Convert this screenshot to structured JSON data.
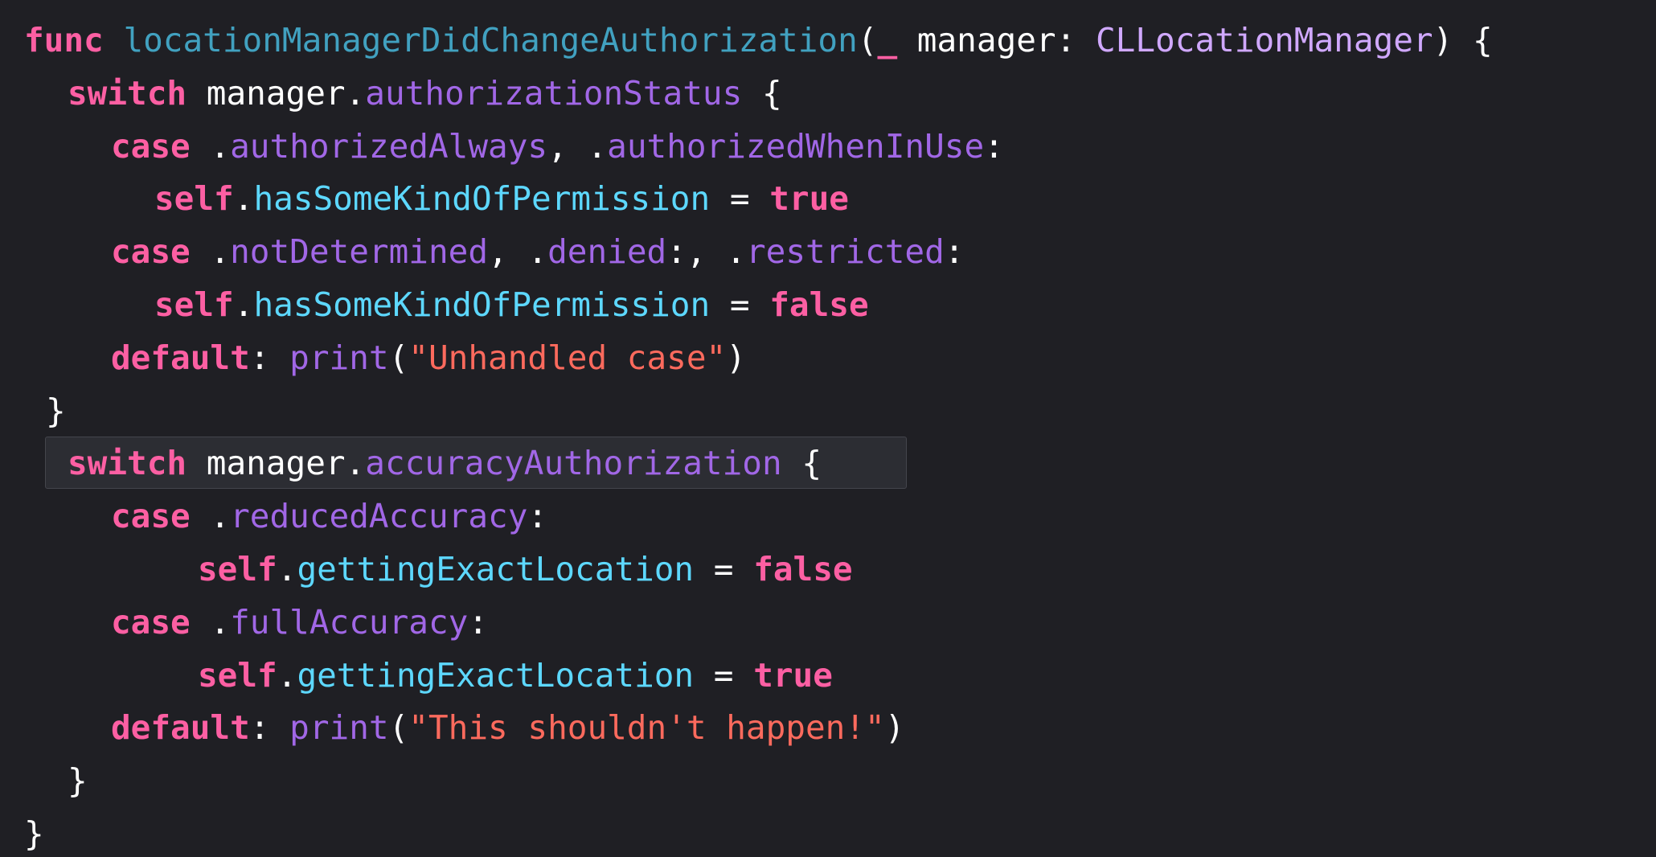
{
  "colors": {
    "background": "#1f1f24",
    "keyword": "#fc5fa3",
    "function_name": "#41a1c0",
    "type": "#d0a8ff",
    "property": "#a167e6",
    "plain": "#ffffff",
    "string": "#fc6a5d",
    "instance_property": "#5dd8ff",
    "highlight": "#2c2d33"
  },
  "code": {
    "lines": [
      {
        "indent": 0,
        "highlighted": false,
        "tokens": [
          {
            "text": "func",
            "kind": "keyword"
          },
          {
            "text": " ",
            "kind": "plain"
          },
          {
            "text": "locationManagerDidChangeAuthorization",
            "kind": "function_name"
          },
          {
            "text": "(",
            "kind": "plain"
          },
          {
            "text": "_",
            "kind": "keyword"
          },
          {
            "text": " manager: ",
            "kind": "plain"
          },
          {
            "text": "CLLocationManager",
            "kind": "type"
          },
          {
            "text": ") {",
            "kind": "plain"
          }
        ]
      },
      {
        "indent": 1,
        "highlighted": false,
        "tokens": [
          {
            "text": "switch",
            "kind": "keyword"
          },
          {
            "text": " manager.",
            "kind": "plain"
          },
          {
            "text": "authorizationStatus",
            "kind": "property"
          },
          {
            "text": " {",
            "kind": "plain"
          }
        ]
      },
      {
        "indent": 2,
        "highlighted": false,
        "tokens": [
          {
            "text": "case",
            "kind": "keyword"
          },
          {
            "text": " .",
            "kind": "plain"
          },
          {
            "text": "authorizedAlways",
            "kind": "property"
          },
          {
            "text": ", .",
            "kind": "plain"
          },
          {
            "text": "authorizedWhenInUse",
            "kind": "property"
          },
          {
            "text": ":",
            "kind": "plain"
          }
        ]
      },
      {
        "indent": 3,
        "highlighted": false,
        "tokens": [
          {
            "text": "self",
            "kind": "keyword"
          },
          {
            "text": ".",
            "kind": "plain"
          },
          {
            "text": "hasSomeKindOfPermission",
            "kind": "instance_property"
          },
          {
            "text": " = ",
            "kind": "plain"
          },
          {
            "text": "true",
            "kind": "keyword"
          }
        ]
      },
      {
        "indent": 2,
        "highlighted": false,
        "tokens": [
          {
            "text": "case",
            "kind": "keyword"
          },
          {
            "text": " .",
            "kind": "plain"
          },
          {
            "text": "notDetermined",
            "kind": "property"
          },
          {
            "text": ", .",
            "kind": "plain"
          },
          {
            "text": "denied",
            "kind": "property"
          },
          {
            "text": ":, .",
            "kind": "plain"
          },
          {
            "text": "restricted",
            "kind": "property"
          },
          {
            "text": ":",
            "kind": "plain"
          }
        ]
      },
      {
        "indent": 3,
        "highlighted": false,
        "tokens": [
          {
            "text": "self",
            "kind": "keyword"
          },
          {
            "text": ".",
            "kind": "plain"
          },
          {
            "text": "hasSomeKindOfPermission",
            "kind": "instance_property"
          },
          {
            "text": " = ",
            "kind": "plain"
          },
          {
            "text": "false",
            "kind": "keyword"
          }
        ]
      },
      {
        "indent": 2,
        "highlighted": false,
        "tokens": [
          {
            "text": "default",
            "kind": "keyword"
          },
          {
            "text": ": ",
            "kind": "plain"
          },
          {
            "text": "print",
            "kind": "property"
          },
          {
            "text": "(",
            "kind": "plain"
          },
          {
            "text": "\"Unhandled case\"",
            "kind": "string"
          },
          {
            "text": ")",
            "kind": "plain"
          }
        ]
      },
      {
        "indent": 0.5,
        "highlighted": false,
        "tokens": [
          {
            "text": "}",
            "kind": "plain"
          }
        ]
      },
      {
        "indent": 1,
        "highlighted": true,
        "tokens": [
          {
            "text": "switch",
            "kind": "keyword"
          },
          {
            "text": " manager.",
            "kind": "plain"
          },
          {
            "text": "accuracyAuthorization",
            "kind": "property"
          },
          {
            "text": " {",
            "kind": "plain"
          }
        ]
      },
      {
        "indent": 2,
        "highlighted": false,
        "tokens": [
          {
            "text": "case",
            "kind": "keyword"
          },
          {
            "text": " .",
            "kind": "plain"
          },
          {
            "text": "reducedAccuracy",
            "kind": "property"
          },
          {
            "text": ":",
            "kind": "plain"
          }
        ]
      },
      {
        "indent": 4,
        "highlighted": false,
        "tokens": [
          {
            "text": "self",
            "kind": "keyword"
          },
          {
            "text": ".",
            "kind": "plain"
          },
          {
            "text": "gettingExactLocation",
            "kind": "instance_property"
          },
          {
            "text": " = ",
            "kind": "plain"
          },
          {
            "text": "false",
            "kind": "keyword"
          }
        ]
      },
      {
        "indent": 2,
        "highlighted": false,
        "tokens": [
          {
            "text": "case",
            "kind": "keyword"
          },
          {
            "text": " .",
            "kind": "plain"
          },
          {
            "text": "fullAccuracy",
            "kind": "property"
          },
          {
            "text": ":",
            "kind": "plain"
          }
        ]
      },
      {
        "indent": 4,
        "highlighted": false,
        "tokens": [
          {
            "text": "self",
            "kind": "keyword"
          },
          {
            "text": ".",
            "kind": "plain"
          },
          {
            "text": "gettingExactLocation",
            "kind": "instance_property"
          },
          {
            "text": " = ",
            "kind": "plain"
          },
          {
            "text": "true",
            "kind": "keyword"
          }
        ]
      },
      {
        "indent": 2,
        "highlighted": false,
        "tokens": [
          {
            "text": "default",
            "kind": "keyword"
          },
          {
            "text": ": ",
            "kind": "plain"
          },
          {
            "text": "print",
            "kind": "property"
          },
          {
            "text": "(",
            "kind": "plain"
          },
          {
            "text": "\"This shouldn't happen!\"",
            "kind": "string"
          },
          {
            "text": ")",
            "kind": "plain"
          }
        ]
      },
      {
        "indent": 1,
        "highlighted": false,
        "tokens": [
          {
            "text": "}",
            "kind": "plain"
          }
        ]
      },
      {
        "indent": 0,
        "highlighted": false,
        "tokens": [
          {
            "text": "}",
            "kind": "plain"
          }
        ]
      }
    ]
  }
}
